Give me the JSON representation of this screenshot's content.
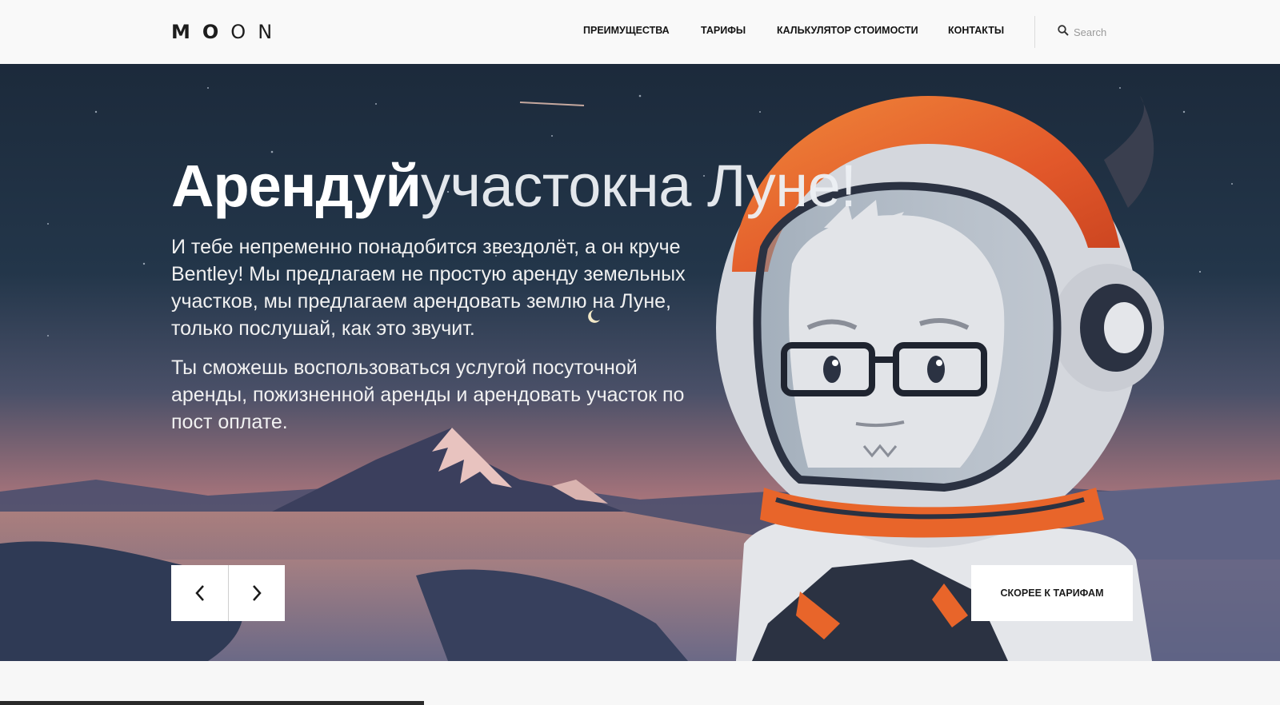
{
  "header": {
    "logo": {
      "part1": "MO",
      "part2": "ON"
    },
    "nav": [
      {
        "label": "ПРЕИМУЩЕСТВА"
      },
      {
        "label": "ТАРИФЫ"
      },
      {
        "label": "КАЛЬКУЛЯТОР СТОИМОСТИ"
      },
      {
        "label": "КОНТАКТЫ"
      }
    ],
    "search": {
      "placeholder": "Search",
      "icon": "search-icon"
    }
  },
  "hero": {
    "title_bold": "Арендуй",
    "title_light": "участокна Луне!",
    "paragraph1": "И тебе непременно понадобится звездолёт, а он круче Bentley! Мы предлагаем не простую аренду земельных участков, мы предлагаем арендовать землю на Луне, только послушай, как это звучит.",
    "paragraph2": "Ты сможешь воспользоваться услугой посуточной аренды, пожизненной аренды и арендовать участок по пост оплате.",
    "prev_icon": "chevron-left-icon",
    "next_icon": "chevron-right-icon",
    "cta_label": "СКОРЕЕ К ТАРИФАМ"
  },
  "colors": {
    "sky_top": "#1e2c3e",
    "sky_mid": "#3a4a60",
    "horizon": "#c98a7a",
    "helmet_orange": "#e8652a",
    "mountain": "#3a3f5c"
  }
}
